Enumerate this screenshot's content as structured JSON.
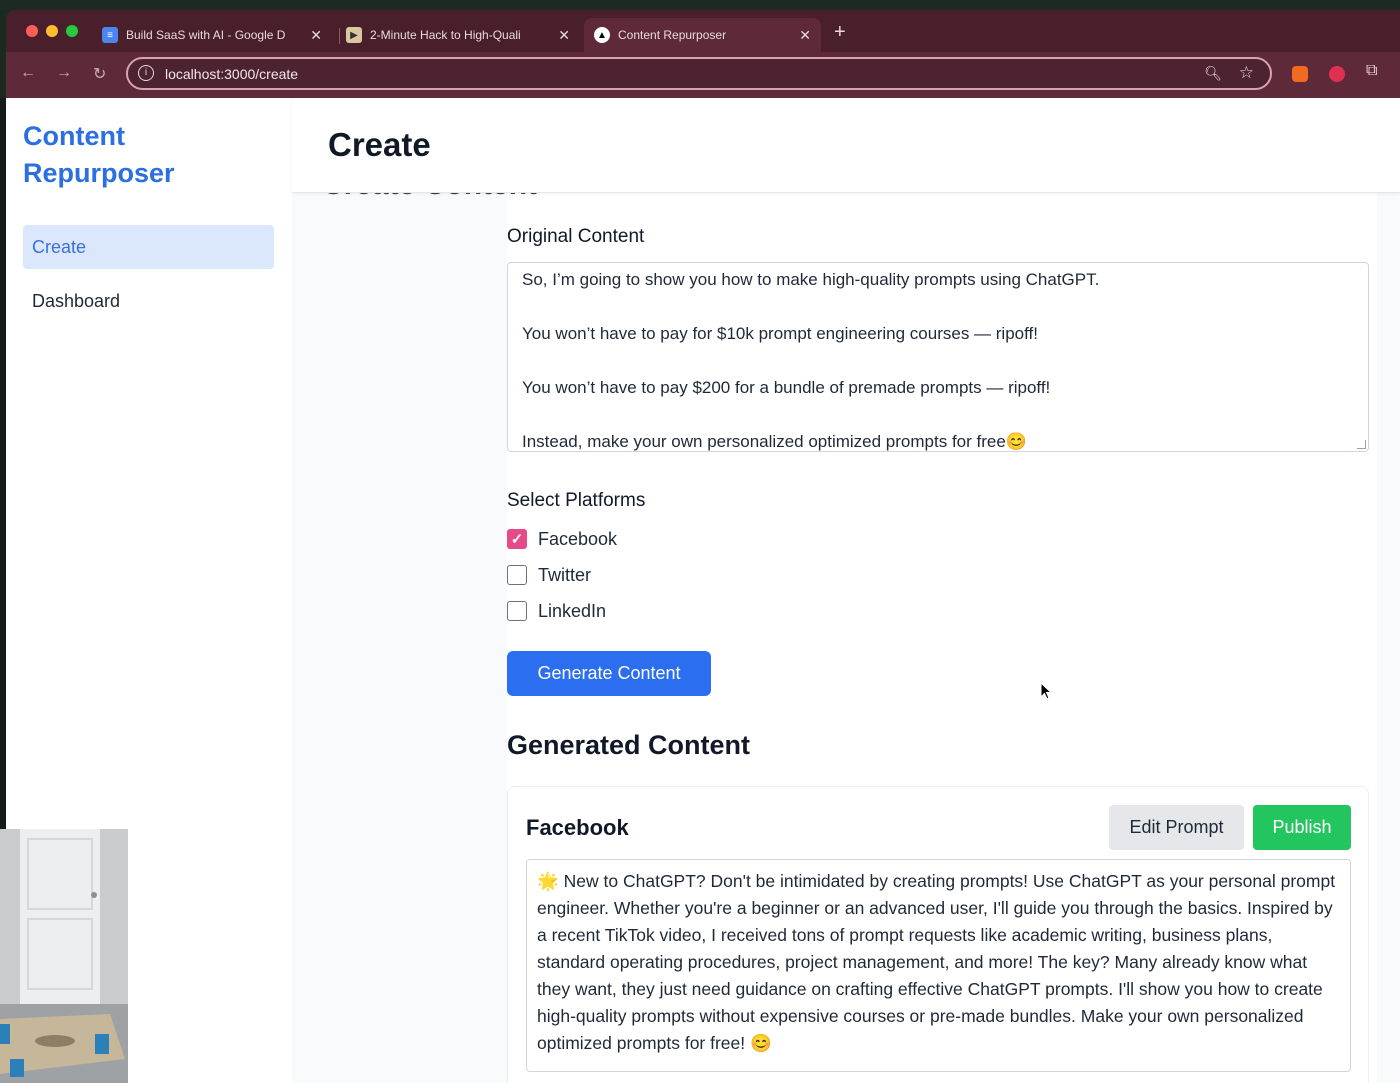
{
  "browser": {
    "tabs": [
      {
        "title": "Build SaaS with AI - Google D",
        "icon": "google-docs-icon"
      },
      {
        "title": "2-Minute Hack to High-Quali",
        "icon": "video-thumbnail-icon"
      },
      {
        "title": "Content Repurposer",
        "icon": "app-logo-icon"
      }
    ],
    "active_tab": 2,
    "url": "localhost:3000/create",
    "colors": {
      "chrome": "#4a1f2c",
      "toolbar": "#5e2a39"
    }
  },
  "sidebar": {
    "brand_line1": "Content",
    "brand_line2": "Repurposer",
    "items": [
      {
        "label": "Create",
        "active": true
      },
      {
        "label": "Dashboard",
        "active": false
      }
    ]
  },
  "header": {
    "title": "Create",
    "behind_title": "Create Content"
  },
  "form": {
    "original_label": "Original Content",
    "original_lines": [
      "So, I’m going to show you how to make high-quality prompts using ChatGPT.",
      "",
      "You won’t have to pay for $10k prompt engineering courses — ripoff!",
      "",
      "You won’t have to pay $200 for a bundle of premade prompts — ripoff!",
      "",
      "Instead, make your own personalized optimized prompts for free😊"
    ],
    "platforms_label": "Select Platforms",
    "platforms": [
      {
        "label": "Facebook",
        "checked": true
      },
      {
        "label": "Twitter",
        "checked": false
      },
      {
        "label": "LinkedIn",
        "checked": false
      }
    ],
    "generate_button": "Generate Content"
  },
  "generated": {
    "heading": "Generated Content",
    "card_title": "Facebook",
    "edit_button": "Edit Prompt",
    "publish_button": "Publish",
    "text": "🌟 New to ChatGPT? Don't be intimidated by creating prompts! Use ChatGPT as your personal prompt engineer. Whether you're a beginner or an advanced user, I'll guide you through the basics. Inspired by a recent TikTok video, I received tons of prompt requests like academic writing, business plans, standard operating procedures, project management, and more! The key? Many already know what they want, they just need guidance on crafting effective ChatGPT prompts. I'll show you how to create high-quality prompts without expensive courses or pre-made bundles. Make your own personalized optimized prompts for free! 😊"
  },
  "accent_colors": {
    "brand": "#2c6fe0",
    "primary_button": "#2b6ff0",
    "publish_button": "#22c55e",
    "checkbox": "#e64a8b"
  }
}
